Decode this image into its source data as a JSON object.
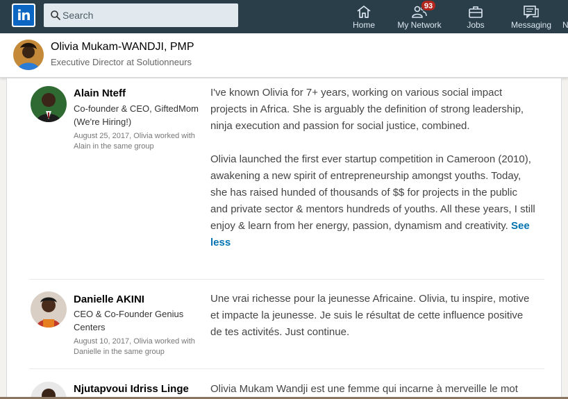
{
  "nav": {
    "logo_text": "in",
    "search_placeholder": "Search",
    "items": [
      {
        "label": "Home",
        "icon": "home-icon"
      },
      {
        "label": "My Network",
        "icon": "network-icon",
        "badge": "93"
      },
      {
        "label": "Jobs",
        "icon": "briefcase-icon"
      },
      {
        "label": "Messaging",
        "icon": "messaging-icon"
      },
      {
        "label": "N",
        "icon": "notifications-icon"
      }
    ]
  },
  "profile": {
    "name": "Olivia Mukam-WANDJI, PMP",
    "headline": "Executive Director at Solutionneurs"
  },
  "recommendations": [
    {
      "name": "Alain Nteff",
      "title": "Co-founder & CEO, GiftedMom (We're Hiring!)",
      "meta": "August 25, 2017, Olivia worked with Alain in the same group",
      "paragraphs": [
        "I've known Olivia for 7+ years, working on various social impact projects in Africa. She is arguably the definition of strong leadership, ninja execution and passion for social justice, combined.",
        "Olivia launched the first ever startup competition in Cameroon (2010), awakening a new spirit of entrepreneurship amongst youths. Today, she has raised hunded of thousands of $$ for projects in the public and private sector & mentors hundreds of youths. All these years, I still enjoy & learn from her energy, passion, dynamism and creativity."
      ],
      "toggle": "See less"
    },
    {
      "name": "Danielle AKINI",
      "title": "CEO & Co-Founder Genius Centers",
      "meta": "August 10, 2017, Olivia worked with Danielle in the same group",
      "paragraphs": [
        "Une vrai richesse pour la jeunesse Africaine. Olivia, tu inspire, motive et impacte la jeunesse. Je suis le résultat de cette influence positive de tes activités. Just continue."
      ]
    },
    {
      "name": "Njutapvoui Idriss Linge",
      "paragraphs": [
        "Olivia Mukam Wandji est une femme qui incarne à merveille le mot"
      ]
    }
  ],
  "colors": {
    "nav_bg": "#293e49",
    "link": "#0073b1",
    "badge": "#b3261e"
  }
}
